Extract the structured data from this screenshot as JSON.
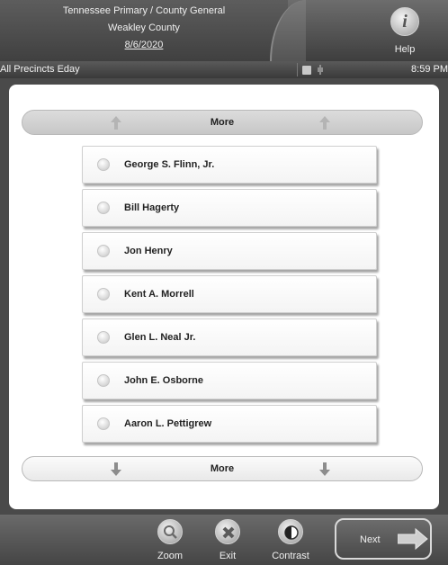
{
  "header": {
    "election": "Tennessee Primary / County General",
    "county": "Weakley County",
    "date": "8/6/2020",
    "help_label": "Help",
    "help_icon": "info-icon"
  },
  "status": {
    "precinct": "All Precincts Eday",
    "time": "8:59 PM",
    "icons": [
      "notes-icon",
      "power-plug-icon"
    ]
  },
  "nav": {
    "more_top": "More",
    "more_bottom": "More"
  },
  "candidates": [
    "George S. Flinn, Jr.",
    "Bill Hagerty",
    "Jon Henry",
    "Kent A. Morrell",
    "Glen L. Neal Jr.",
    "John E. Osborne",
    "Aaron L. Pettigrew"
  ],
  "footer": {
    "zoom": "Zoom",
    "exit": "Exit",
    "contrast": "Contrast",
    "next": "Next"
  },
  "colors": {
    "chrome": "#4a4a4a",
    "panel": "#ffffff",
    "text_dark": "#222222",
    "text_light": "#f0f0f0"
  }
}
